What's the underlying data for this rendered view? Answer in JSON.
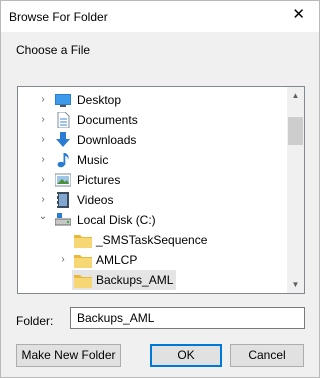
{
  "window": {
    "title": "Browse For Folder",
    "close_glyph": "✕"
  },
  "prompt": "Choose a File",
  "tree": {
    "items": [
      {
        "label": "Desktop",
        "icon": "desktop-icon",
        "chevron": "›"
      },
      {
        "label": "Documents",
        "icon": "documents-icon",
        "chevron": "›"
      },
      {
        "label": "Downloads",
        "icon": "downloads-icon",
        "chevron": "›"
      },
      {
        "label": "Music",
        "icon": "music-icon",
        "chevron": "›"
      },
      {
        "label": "Pictures",
        "icon": "pictures-icon",
        "chevron": "›"
      },
      {
        "label": "Videos",
        "icon": "videos-icon",
        "chevron": "›"
      },
      {
        "label": "Local Disk (C:)",
        "icon": "drive-icon",
        "chevron": "⌄"
      },
      {
        "label": "_SMSTaskSequence",
        "icon": "folder-icon",
        "chevron": ""
      },
      {
        "label": "AMLCP",
        "icon": "folder-icon",
        "chevron": "›"
      },
      {
        "label": "Backups_AML",
        "icon": "folder-icon",
        "chevron": "",
        "selected": true
      }
    ]
  },
  "folder_field": {
    "label": "Folder:",
    "value": "Backups_AML"
  },
  "buttons": {
    "make_new": "Make New Folder",
    "ok": "OK",
    "cancel": "Cancel"
  },
  "colors": {
    "accent": "#0078d7",
    "selection": "#e5e5e5",
    "folder": "#f7d774"
  }
}
